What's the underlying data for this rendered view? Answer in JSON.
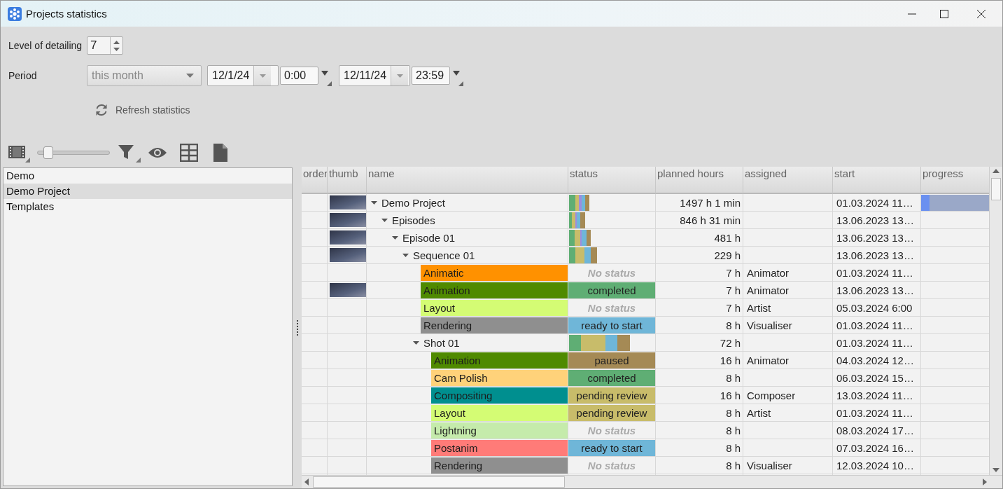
{
  "window": {
    "title": "Projects statistics"
  },
  "detailing": {
    "label": "Level of detailing",
    "value": "7"
  },
  "period": {
    "label": "Period",
    "preset": "this month",
    "preset_disabled": true,
    "from_date": "12/1/24",
    "from_time": "0:00",
    "to_date": "12/11/24",
    "to_time": "23:59"
  },
  "refresh_button": "Refresh statistics",
  "thumbnail_size_slider": {
    "level": 0.1
  },
  "projects": [
    {
      "label": "Demo",
      "selected": false
    },
    {
      "label": "Demo Project",
      "selected": true
    },
    {
      "label": "Templates",
      "selected": false
    }
  ],
  "table": {
    "columns": [
      "order",
      "thumb",
      "name",
      "status",
      "planned hours",
      "assigned",
      "start",
      "progress"
    ],
    "rows": [
      {
        "kind": "group",
        "name": "Demo Project",
        "expanded": true,
        "thumb": true,
        "planned_hours": "1497 h 1 min",
        "start": "01.03.2024 11…",
        "progress": {
          "level": 0.12
        },
        "children": [
          {
            "kind": "group",
            "name": "Episodes",
            "expanded": true,
            "thumb": true,
            "planned_hours": "846 h 31 min",
            "start": "13.06.2023 13…",
            "children": [
              {
                "kind": "group",
                "name": "Episode 01",
                "expanded": true,
                "thumb": true,
                "planned_hours": "481 h",
                "start": "13.06.2023 13…",
                "children": [
                  {
                    "kind": "group",
                    "name": "Sequence 01",
                    "expanded": true,
                    "thumb": true,
                    "planned_hours": "229 h",
                    "start": "13.06.2023 13…",
                    "children": [
                      {
                        "kind": "task",
                        "name": "Animatic",
                        "color": "#ff9100",
                        "status": {
                          "kind": "none",
                          "label": "No status"
                        },
                        "planned_hours": "7 h",
                        "assigned": "Animator",
                        "start": "01.03.2024 11…"
                      },
                      {
                        "kind": "task",
                        "name": "Animation",
                        "color": "#4f8a00",
                        "thumb": true,
                        "status": {
                          "kind": "set",
                          "label": "completed",
                          "color": "#5fae74"
                        },
                        "planned_hours": "7 h",
                        "assigned": "Animator",
                        "start": "13.06.2023 13…"
                      },
                      {
                        "kind": "task",
                        "name": "Layout",
                        "color": "#d4fc74",
                        "status": {
                          "kind": "none",
                          "label": "No status"
                        },
                        "planned_hours": "7 h",
                        "assigned": "Artist",
                        "start": "05.03.2024 6:00"
                      },
                      {
                        "kind": "task",
                        "name": "Rendering",
                        "color": "#8f8f8f",
                        "status": {
                          "kind": "set",
                          "label": "ready to start",
                          "color": "#6fb6d8"
                        },
                        "planned_hours": "8 h",
                        "assigned": "Visualiser",
                        "start": "01.03.2024 11…"
                      },
                      {
                        "kind": "group",
                        "name": "Shot 01",
                        "expanded": true,
                        "planned_hours": "72 h",
                        "start": "01.03.2024 11…",
                        "children": [
                          {
                            "kind": "task",
                            "name": "Animation",
                            "color": "#4f8a00",
                            "status": {
                              "kind": "set",
                              "label": "paused",
                              "color": "#a58a55"
                            },
                            "planned_hours": "16 h",
                            "assigned": "Animator",
                            "start": "04.03.2024 12…"
                          },
                          {
                            "kind": "task",
                            "name": "Cam Polish",
                            "color": "#ffd27a",
                            "status": {
                              "kind": "set",
                              "label": "completed",
                              "color": "#5fae74"
                            },
                            "planned_hours": "8 h",
                            "start": "06.03.2024 15…"
                          },
                          {
                            "kind": "task",
                            "name": "Compositing",
                            "color": "#008f8f",
                            "status": {
                              "kind": "set",
                              "label": "pending review",
                              "color": "#c8bc6a"
                            },
                            "planned_hours": "16 h",
                            "assigned": "Composer",
                            "start": "13.03.2024 11…"
                          },
                          {
                            "kind": "task",
                            "name": "Layout",
                            "color": "#d4fc74",
                            "status": {
                              "kind": "set",
                              "label": "pending review",
                              "color": "#c8bc6a"
                            },
                            "planned_hours": "8 h",
                            "assigned": "Artist",
                            "start": "01.03.2024 11…"
                          },
                          {
                            "kind": "task",
                            "name": "Lightning",
                            "color": "#c5ebab",
                            "status": {
                              "kind": "none",
                              "label": "No status"
                            },
                            "planned_hours": "8 h",
                            "start": "08.03.2024 17…"
                          },
                          {
                            "kind": "task",
                            "name": "Postanim",
                            "color": "#ff7b78",
                            "status": {
                              "kind": "set",
                              "label": "ready to start",
                              "color": "#6fb6d8"
                            },
                            "planned_hours": "8 h",
                            "start": "07.03.2024 16…"
                          },
                          {
                            "kind": "task",
                            "name": "Rendering",
                            "color": "#8f8f8f",
                            "status": {
                              "kind": "none",
                              "label": "No status"
                            },
                            "planned_hours": "8 h",
                            "assigned": "Visualiser",
                            "start": "12.03.2024 10…"
                          }
                        ]
                      }
                    ]
                  }
                ]
              }
            ]
          }
        ]
      }
    ]
  }
}
